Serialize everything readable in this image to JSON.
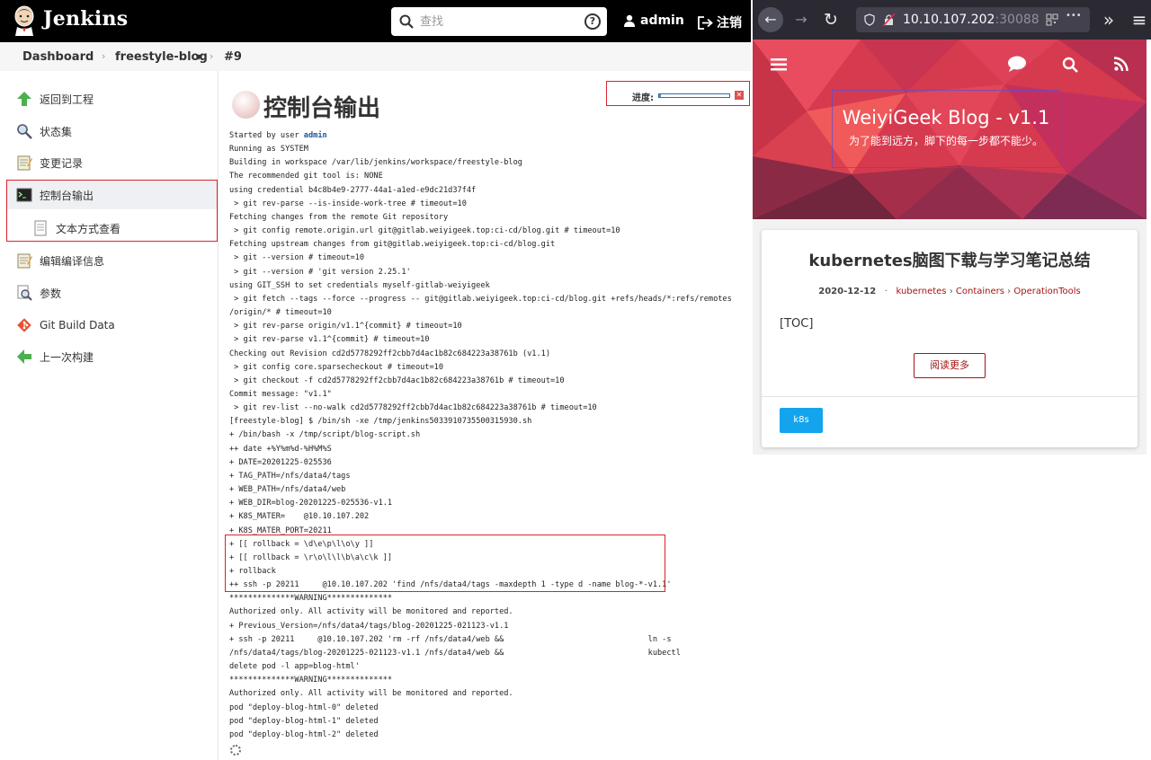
{
  "jenkins": {
    "app_title": "Jenkins",
    "search": {
      "placeholder": "查找",
      "help": "?"
    },
    "user": "admin",
    "logout": "注销",
    "breadcrumb": {
      "dashboard": "Dashboard",
      "job": "freestyle-blog",
      "build": "#9",
      "sep": "›"
    },
    "sidebar": [
      {
        "label": "返回到工程",
        "icon": "up-arrow-icon"
      },
      {
        "label": "状态集",
        "icon": "magnifier-icon"
      },
      {
        "label": "变更记录",
        "icon": "notepad-icon"
      },
      {
        "label": "控制台输出",
        "icon": "terminal-icon"
      },
      {
        "label": "文本方式查看",
        "icon": "document-icon"
      },
      {
        "label": "编辑编译信息",
        "icon": "notepad-icon"
      },
      {
        "label": "参数",
        "icon": "magnifier-doc-icon"
      },
      {
        "label": "Git Build Data",
        "icon": "git-icon"
      },
      {
        "label": "上一次构建",
        "icon": "left-arrow-icon"
      }
    ],
    "page_title": "控制台输出",
    "progress": {
      "label": "进度:",
      "fraction": 0.02
    },
    "console": {
      "started_by_prefix": "Started by user ",
      "started_by_user": "admin",
      "lines": [
        "Running as SYSTEM",
        "Building in workspace /var/lib/jenkins/workspace/freestyle-blog",
        "The recommended git tool is: NONE",
        "using credential b4c8b4e9-2777-44a1-a1ed-e9dc21d37f4f",
        " > git rev-parse --is-inside-work-tree # timeout=10",
        "Fetching changes from the remote Git repository",
        " > git config remote.origin.url git@gitlab.weiyigeek.top:ci-cd/blog.git # timeout=10",
        "Fetching upstream changes from git@gitlab.weiyigeek.top:ci-cd/blog.git",
        " > git --version # timeout=10",
        " > git --version # 'git version 2.25.1'",
        "using GIT_SSH to set credentials myself-gitlab-weiyigeek",
        " > git fetch --tags --force --progress -- git@gitlab.weiyigeek.top:ci-cd/blog.git +refs/heads/*:refs/remotes",
        "/origin/* # timeout=10",
        " > git rev-parse origin/v1.1^{commit} # timeout=10",
        " > git rev-parse v1.1^{commit} # timeout=10",
        "Checking out Revision cd2d5778292ff2cbb7d4ac1b82c684223a38761b (v1.1)",
        " > git config core.sparsecheckout # timeout=10",
        " > git checkout -f cd2d5778292ff2cbb7d4ac1b82c684223a38761b # timeout=10",
        "Commit message: \"v1.1\"",
        " > git rev-list --no-walk cd2d5778292ff2cbb7d4ac1b82c684223a38761b # timeout=10",
        "[freestyle-blog] $ /bin/sh -xe /tmp/jenkins5033910735500315930.sh",
        "+ /bin/bash -x /tmp/script/blog-script.sh",
        "++ date +%Y%m%d-%H%M%S",
        "+ DATE=20201225-025536",
        "+ TAG_PATH=/nfs/data4/tags",
        "+ WEB_PATH=/nfs/data4/web",
        "+ WEB_DIR=blog-20201225-025536-v1.1",
        "+ K8S_MATER=    @10.10.107.202",
        "+ K8S_MATER_PORT=20211",
        "+ [[ rollback = \\d\\e\\p\\l\\o\\y ]]",
        "+ [[ rollback = \\r\\o\\l\\l\\b\\a\\c\\k ]]",
        "+ rollback",
        "++ ssh -p 20211     @10.10.107.202 'find /nfs/data4/tags -maxdepth 1 -type d -name blog-*-v1.1'",
        "**************WARNING**************",
        "Authorized only. All activity will be monitored and reported.",
        "+ Previous_Version=/nfs/data4/tags/blog-20201225-021123-v1.1",
        "+ ssh -p 20211     @10.10.107.202 'rm -rf /nfs/data4/web &&                               ln -s",
        "/nfs/data4/tags/blog-20201225-021123-v1.1 /nfs/data4/web &&                               kubectl",
        "delete pod -l app=blog-html'",
        "**************WARNING**************",
        "Authorized only. All activity will be monitored and reported.",
        "pod \"deploy-blog-html-0\" deleted",
        "pod \"deploy-blog-html-1\" deleted",
        "pod \"deploy-blog-html-2\" deleted"
      ]
    }
  },
  "browser": {
    "url_host": "10.10.107.202",
    "url_port": ":30088",
    "buttons": {
      "back": "←",
      "forward": "→",
      "reload": "↻",
      "more": "»",
      "menu": "≡",
      "dots": "•••"
    }
  },
  "blog": {
    "title": "WeiyiGeek Blog - v1.1",
    "subtitle": "为了能到远方，脚下的每一步都不能少。",
    "post": {
      "title": "kubernetes脑图下载与学习笔记总结",
      "date": "2020-12-12",
      "categories": [
        "kubernetes",
        "Containers",
        "OperationTools"
      ],
      "excerpt": "[TOC]",
      "read_more": "阅读更多",
      "tag": "k8s"
    }
  },
  "colors": {
    "jenkins_header": "#000000",
    "highlight_red": "#d9232d",
    "blog_link": "#a31515",
    "tag_blue": "#13a4ee"
  }
}
